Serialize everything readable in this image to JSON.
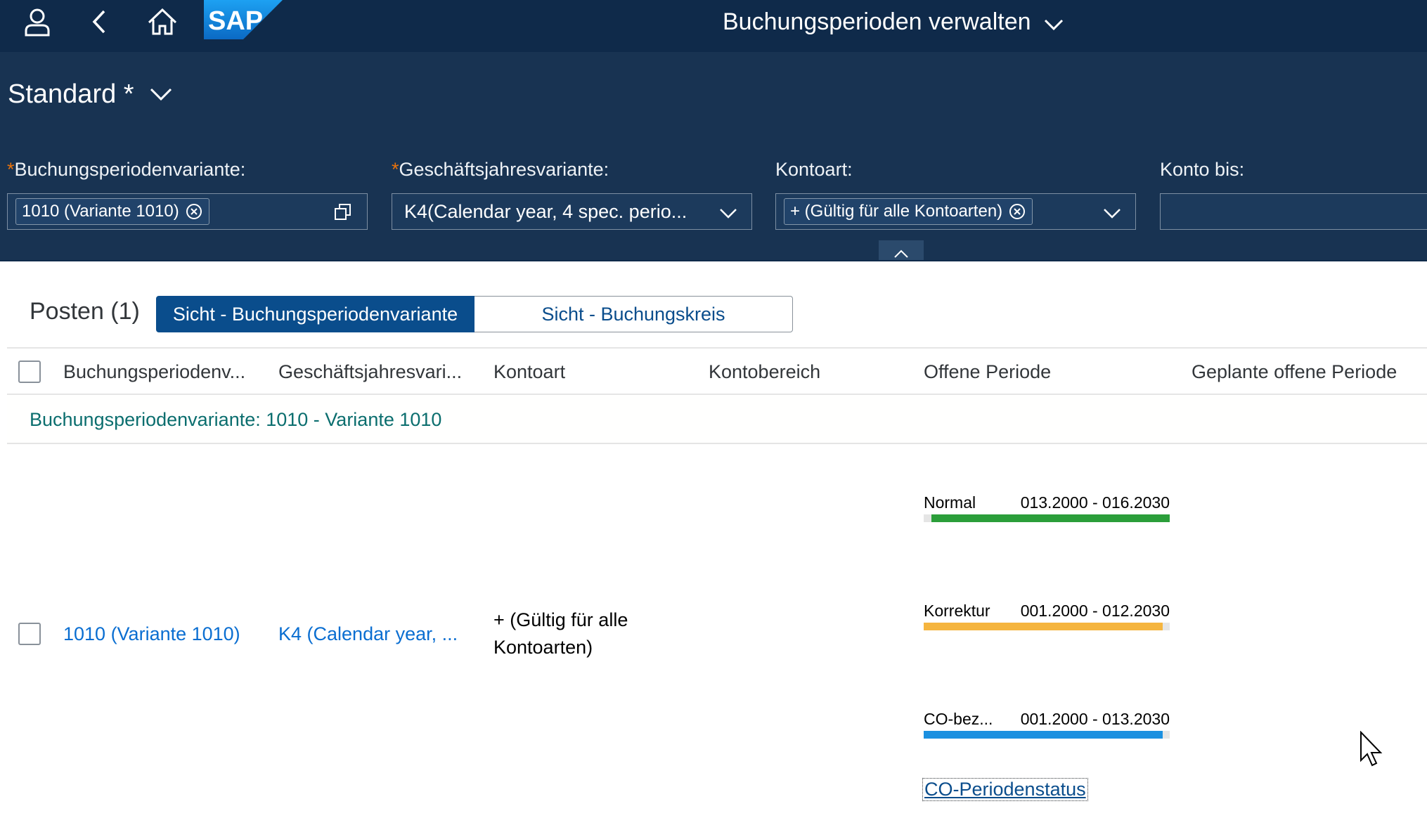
{
  "shell": {
    "title": "Buchungsperioden verwalten",
    "logo_text": "SAP",
    "icons": [
      "user-icon",
      "back-icon",
      "home-icon",
      "chevron-down-icon"
    ]
  },
  "header": {
    "variant": "Standard *",
    "filters": [
      {
        "label": "Buchungsperiodenvariante:",
        "required": true,
        "token": "1010 (Variante 1010)"
      },
      {
        "label": "Geschäftsjahresvariante:",
        "required": true,
        "value": "K4(Calendar year, 4 spec. perio..."
      },
      {
        "label": "Kontoart:",
        "required": false,
        "token": "+ (Gültig für alle Kontoarten)"
      },
      {
        "label": "Konto bis:",
        "required": false,
        "value": ""
      }
    ]
  },
  "table": {
    "title": "Posten (1)",
    "segments": [
      "Sicht - Buchungsperiodenvariante",
      "Sicht - Buchungskreis"
    ],
    "columns": [
      "Buchungsperiodenv...",
      "Geschäftsjahresvari...",
      "Kontoart",
      "Kontobereich",
      "Offene Periode",
      "Geplante offene Periode"
    ],
    "group_header": "Buchungsperiodenvariante: 1010 - Variante 1010",
    "row": {
      "variant": "1010 (Variante 1010)",
      "fiscal_year_variant": "K4 (Calendar year, ...",
      "account_type_line1": "+ (Gültig für alle",
      "account_type_line2": "Kontoarten)",
      "periods": [
        {
          "label": "Normal",
          "range": "013.2000 - 016.2030",
          "color": "#2b9e3a",
          "start": 0.03,
          "end": 1.0
        },
        {
          "label": "Korrektur",
          "range": "001.2000 - 012.2030",
          "color": "#f5b53f",
          "start": 0.0,
          "end": 0.97
        },
        {
          "label": "CO-bez...",
          "range": "001.2000 - 013.2030",
          "color": "#1b90e0",
          "start": 0.0,
          "end": 0.97
        }
      ],
      "co_link": "CO-Periodenstatus"
    }
  },
  "colors": {
    "shell_bg": "#0f2a4a",
    "header_bg": "#183352",
    "segment_active": "#0a4d8c",
    "link": "#0a6ed1",
    "group_text": "#0b6e6e"
  }
}
